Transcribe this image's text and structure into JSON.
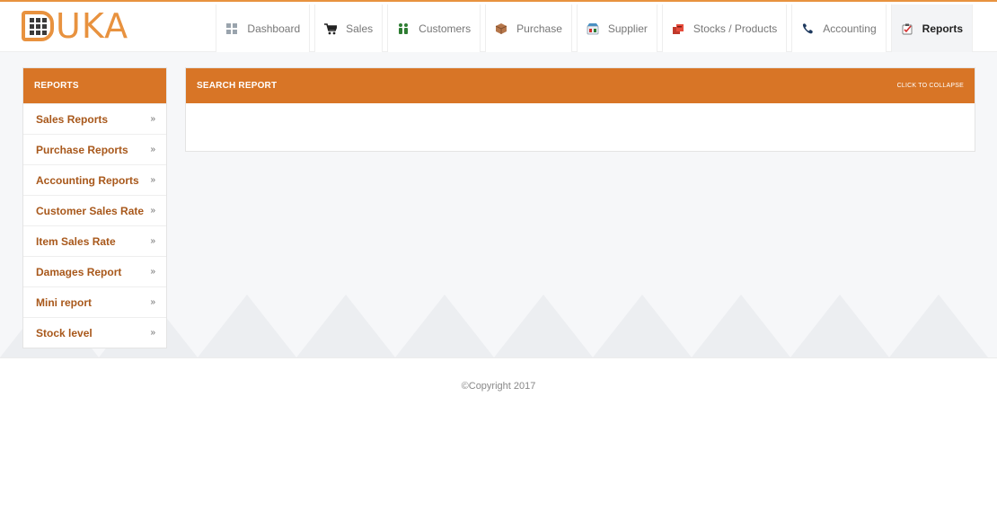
{
  "brand": {
    "logo_text": "UKA",
    "accent_color": "#e8923f",
    "header_color": "#d87526"
  },
  "nav": [
    {
      "label": "Dashboard",
      "icon": "dashboard-grid-icon"
    },
    {
      "label": "Sales",
      "icon": "cart-icon"
    },
    {
      "label": "Customers",
      "icon": "people-icon"
    },
    {
      "label": "Purchase",
      "icon": "box-icon"
    },
    {
      "label": "Supplier",
      "icon": "supplier-icon"
    },
    {
      "label": "Stocks / Products",
      "icon": "stocks-icon"
    },
    {
      "label": "Accounting",
      "icon": "phone-icon"
    },
    {
      "label": "Reports",
      "icon": "reports-icon",
      "active": true
    }
  ],
  "sidebar": {
    "title": "REPORTS",
    "items": [
      {
        "label": "Sales Reports",
        "chevron": "»"
      },
      {
        "label": "Purchase Reports",
        "chevron": "»"
      },
      {
        "label": "Accounting Reports",
        "chevron": "»"
      },
      {
        "label": "Customer Sales Rate",
        "chevron": "»"
      },
      {
        "label": "Item Sales Rate",
        "chevron": "»"
      },
      {
        "label": "Damages Report",
        "chevron": "»"
      },
      {
        "label": "Mini report",
        "chevron": "»"
      },
      {
        "label": "Stock level",
        "chevron": "»"
      }
    ]
  },
  "search_panel": {
    "title": "SEARCH REPORT",
    "collapse_label": "CLICK TO COLLAPSE"
  },
  "footer": {
    "copyright": "©Copyright 2017"
  }
}
